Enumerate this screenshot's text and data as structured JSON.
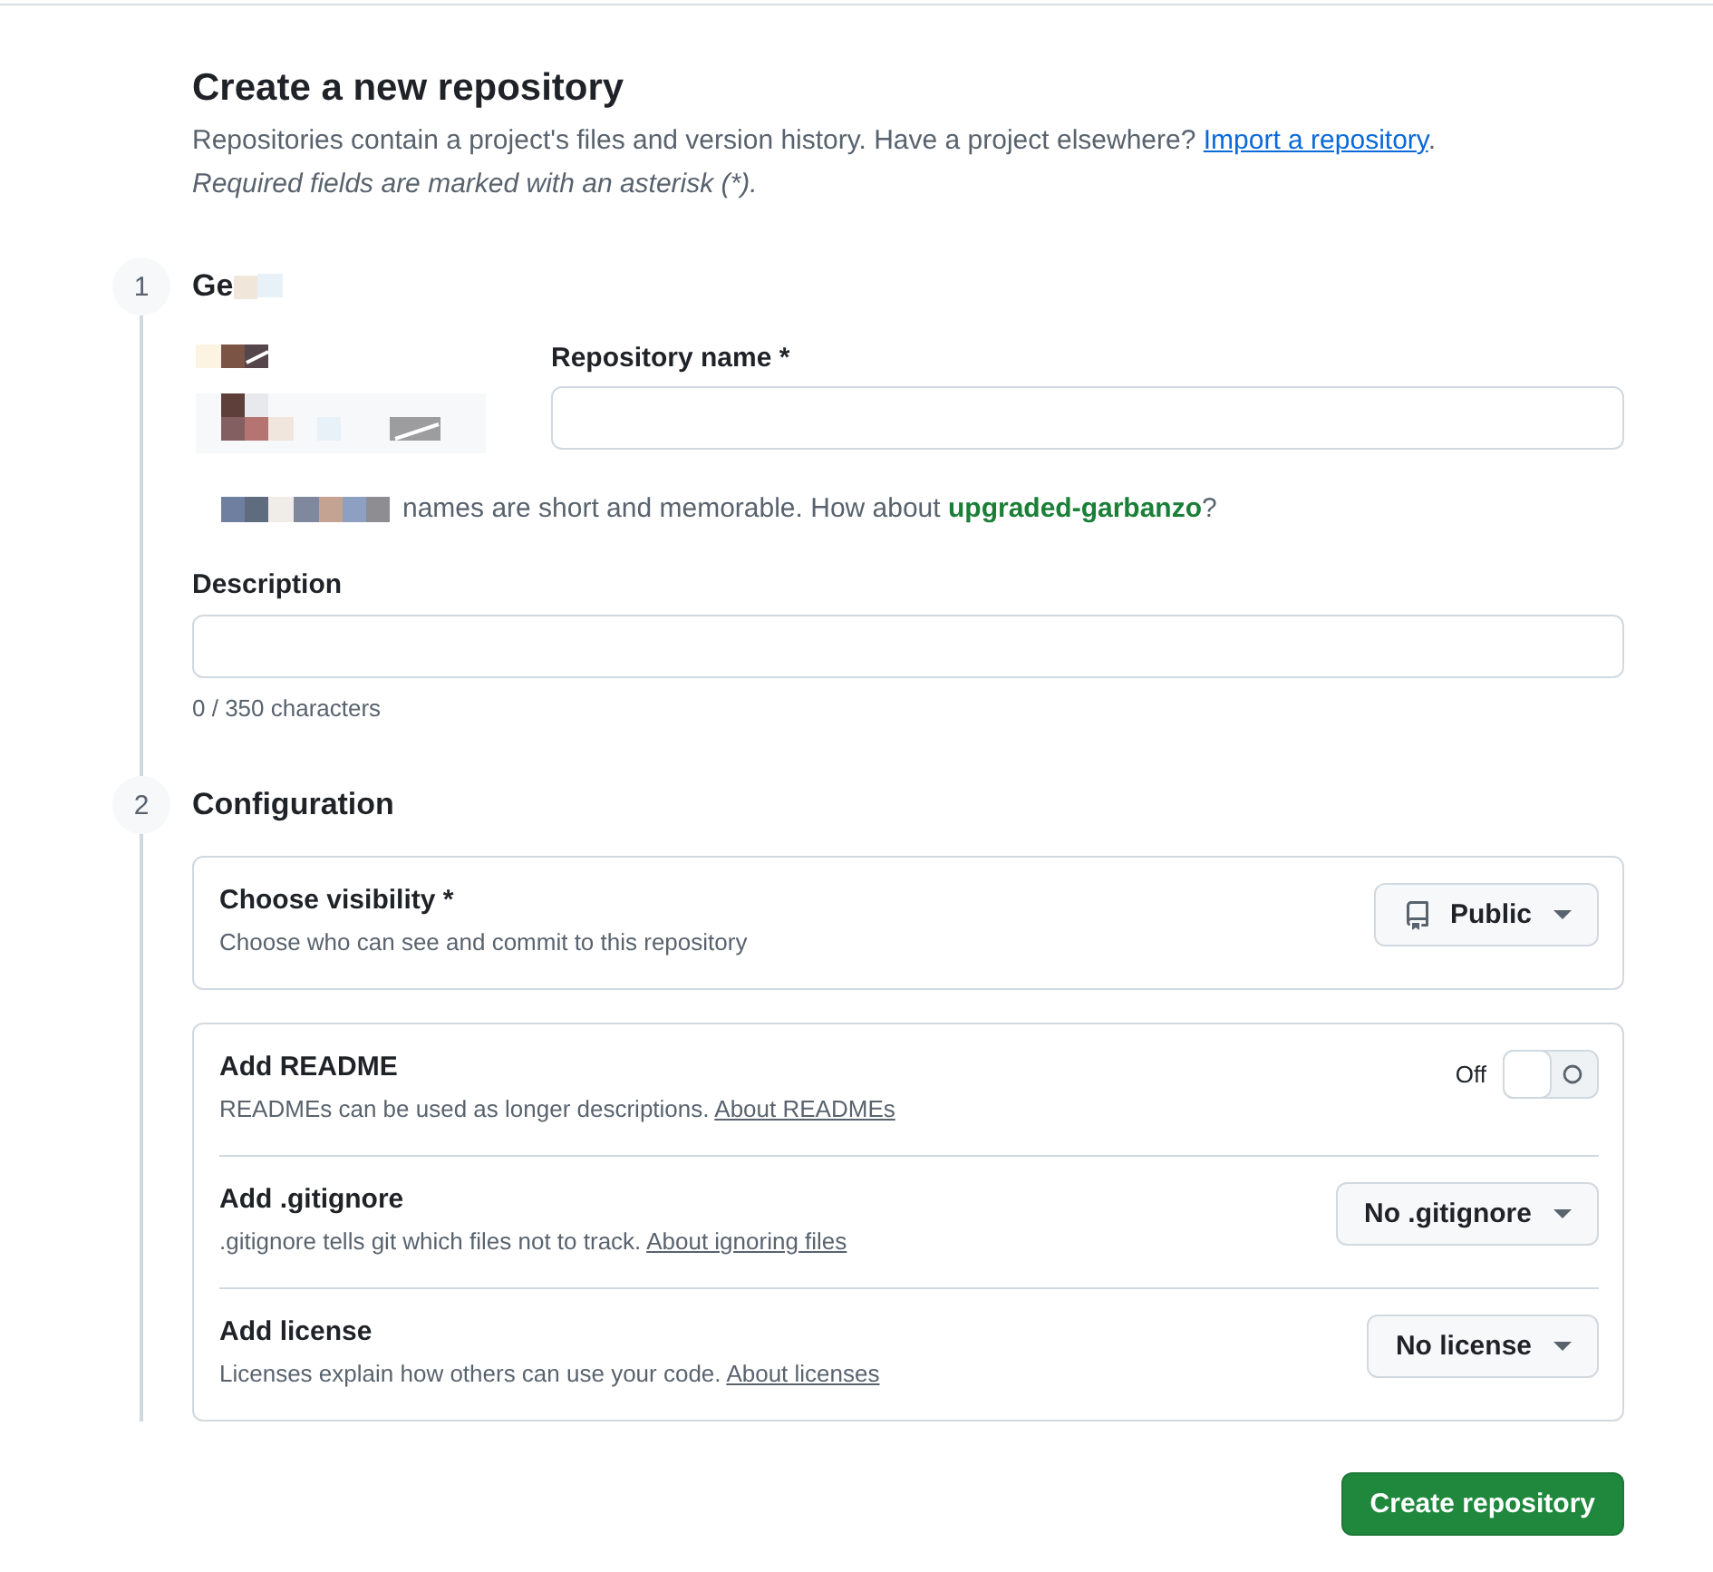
{
  "header": {
    "title": "Create a new repository",
    "intro": "Repositories contain a project's files and version history. Have a project elsewhere?",
    "intro_link": "Import a repository",
    "intro_end": ".",
    "required_note": "Required fields are marked with an asterisk (*)."
  },
  "steps": [
    {
      "kind": "general",
      "number": "1",
      "heading": "Ge",
      "repo_name": {
        "label": "Repository name *"
      },
      "hint": {
        "text": "names are short and memorable. How about",
        "suggestion": "upgraded-garbanzo",
        "end": "?"
      },
      "description": {
        "label": "Description",
        "counter": "0 / 350 characters"
      }
    },
    {
      "kind": "configuration",
      "number": "2",
      "heading": "Configuration",
      "cards": [
        {
          "rows": [
            {
              "kind": "visibility",
              "title": "Choose visibility *",
              "description": "Choose who can see and commit to this repository",
              "value": "Public"
            }
          ]
        },
        {
          "rows": [
            {
              "kind": "toggle",
              "title": "Add README",
              "description": "READMEs can be used as longer descriptions.",
              "link": "About READMEs",
              "state_label": "Off",
              "on": false
            },
            {
              "kind": "select",
              "title": "Add .gitignore",
              "description": ".gitignore tells git which files not to track.",
              "link": "About ignoring files",
              "value": "No .gitignore"
            },
            {
              "kind": "select",
              "title": "Add license",
              "description": "Licenses explain how others can use your code.",
              "link": "About licenses",
              "value": "No license"
            }
          ]
        }
      ]
    }
  ],
  "submit": {
    "label": "Create repository"
  }
}
